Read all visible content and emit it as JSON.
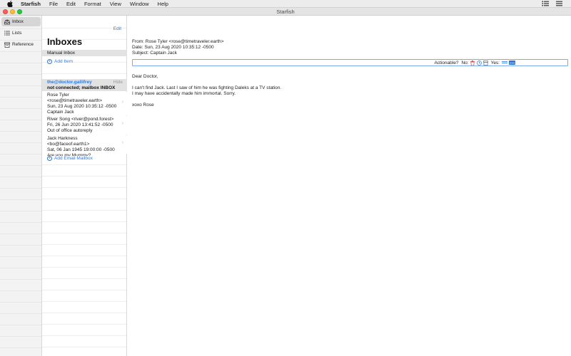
{
  "menubar": {
    "app_name": "Starfish",
    "items": [
      "File",
      "Edit",
      "Format",
      "View",
      "Window",
      "Help"
    ]
  },
  "window": {
    "title": "Starfish"
  },
  "sidebar": {
    "items": [
      {
        "label": "Inbox",
        "icon": "inbox-icon",
        "selected": true
      },
      {
        "label": "Lists",
        "icon": "list-icon",
        "selected": false
      },
      {
        "label": "Reference",
        "icon": "archive-icon",
        "selected": false
      }
    ]
  },
  "list_pane": {
    "edit_label": "Edit",
    "title": "Inboxes",
    "manual_inbox_label": "Manual Inbox",
    "add_item_label": "Add Item",
    "mailbox": {
      "account": "the@doctor.gallifrey",
      "hide_label": "Hide",
      "status": "not connected; mailbox INBOX"
    },
    "messages": [
      {
        "line1": "Rose Tyler",
        "line2": "<rose@timetraveler.earth>",
        "line3": "Sun, 23 Aug 2020 10:35:12 -0500",
        "line4": "Captain Jack"
      },
      {
        "line1": "River Song <river@pond.forest>",
        "line2": "Fri, 26 Jun 2020 13:41:52 -0500",
        "line3": "Out of office autoreply"
      },
      {
        "line1": "Jack Harkness <bo@faceof.earth1>",
        "line2": "Sat, 06 Jan 1945 19:00:00 -0500",
        "line3": "Are you my Mummy?"
      }
    ],
    "add_mailbox_label": "Add Email Mailbox"
  },
  "email": {
    "from": "From: Rose Tyler <rose@timetraveler.earth>",
    "date": "Date: Sun, 23 Aug 2020 10:35:12 -0500",
    "subject": "Subject: Captain Jack",
    "actionable_label": "Actionable?",
    "no_label": "No:",
    "yes_label": "Yes:",
    "body": {
      "greeting": "Dear Doctor,",
      "line1": "I can't find Jack. Last I saw of him he was fighting Daleks at a TV station.",
      "line2": "I may have accidentally made him immortal. Sorry.",
      "signoff": "xoxo Rose"
    }
  },
  "colors": {
    "accent": "#2a7ae2",
    "delete": "#e0443e"
  }
}
